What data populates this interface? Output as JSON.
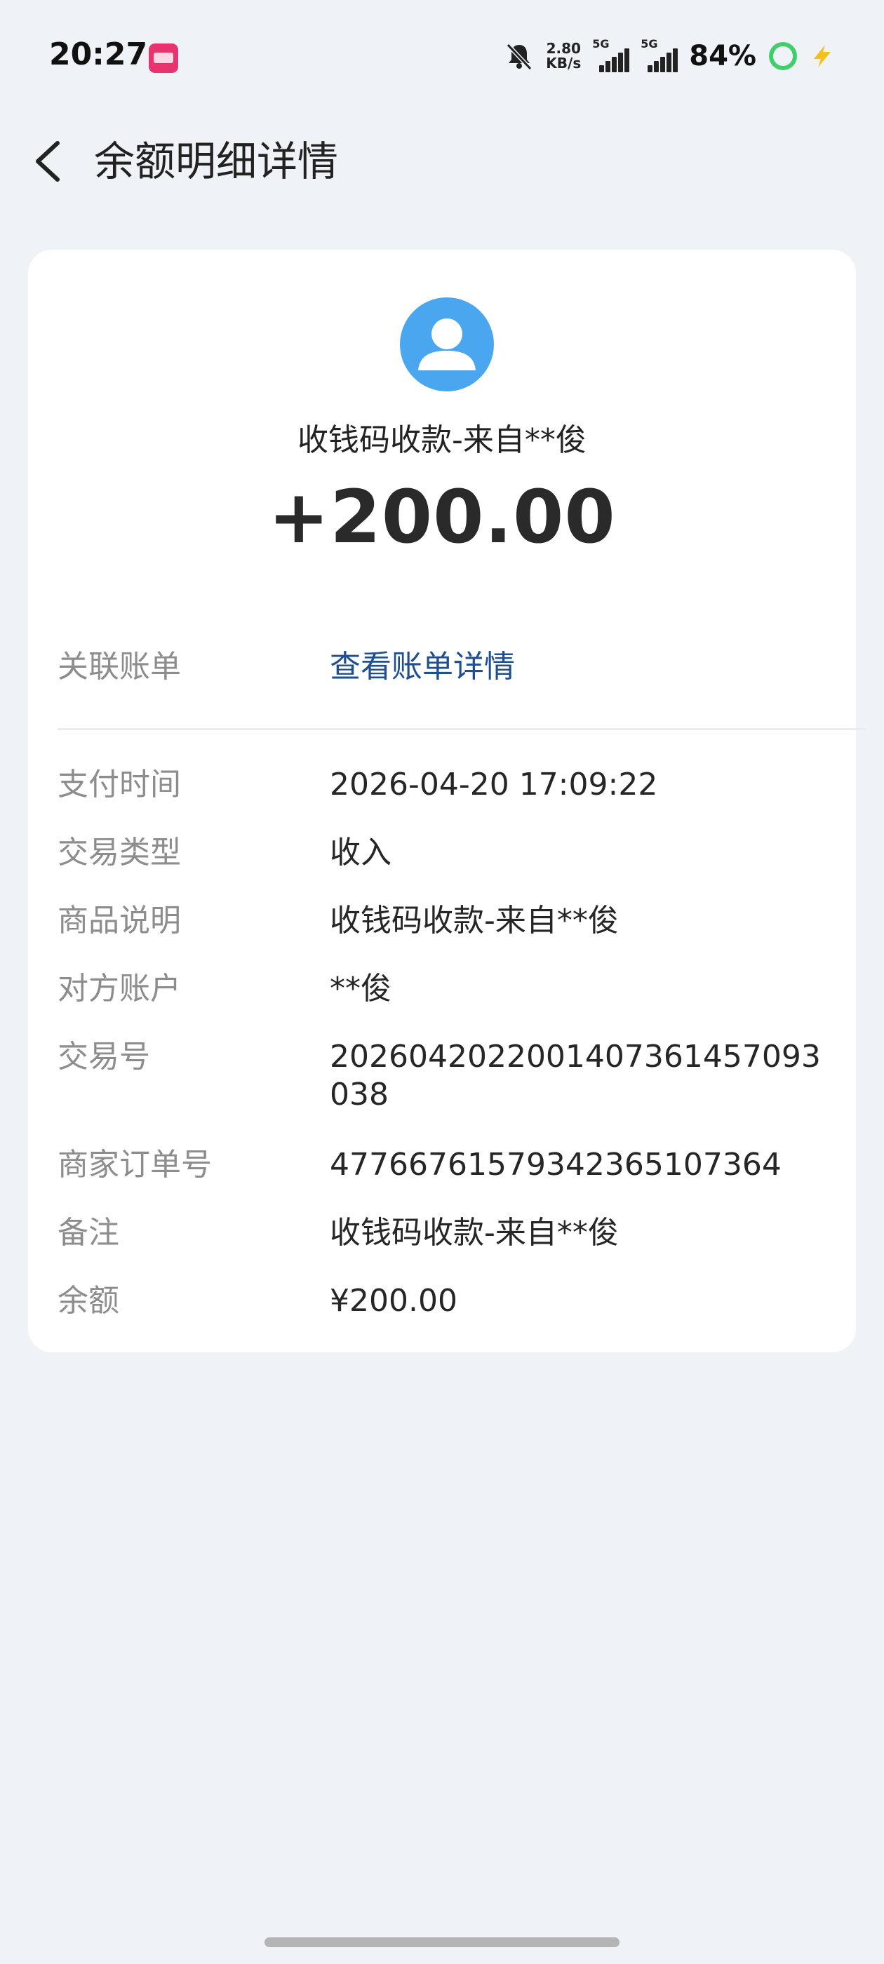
{
  "status_bar": {
    "time": "20:27",
    "net_speed_value": "2.80",
    "net_speed_unit": "KB/s",
    "sim1": "5G",
    "sim2": "5G",
    "battery": "84%"
  },
  "header": {
    "title": "余额明细详情"
  },
  "summary": {
    "title": "收钱码收款-来自**俊",
    "amount": "+200.00"
  },
  "related_bill": {
    "label": "关联账单",
    "link_text": "查看账单详情"
  },
  "details": [
    {
      "label": "支付时间",
      "value": "2026-04-20 17:09:22"
    },
    {
      "label": "交易类型",
      "value": "收入"
    },
    {
      "label": "商品说明",
      "value": "收钱码收款-来自**俊"
    },
    {
      "label": "对方账户",
      "value": "**俊"
    },
    {
      "label": "交易号",
      "value": "2026042022001407361457093038"
    },
    {
      "label": "商家订单号",
      "value": "4776676157934236510​7364"
    },
    {
      "label": "备注",
      "value": "收钱码收款-来自**俊"
    },
    {
      "label": "余额",
      "value": "¥200.00"
    }
  ],
  "colors": {
    "background": "#eff2f7",
    "card": "#ffffff",
    "avatar": "#4aa6ee",
    "link": "#1f4f8f",
    "label": "#8d8d8d"
  }
}
